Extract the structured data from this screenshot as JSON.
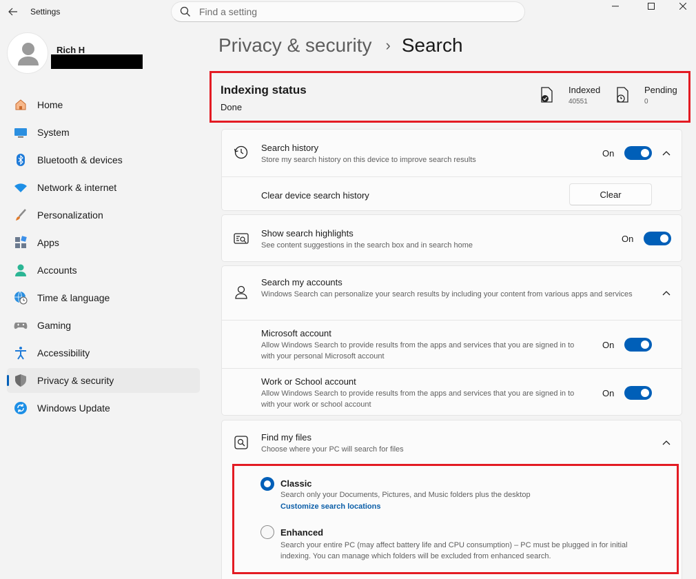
{
  "window": {
    "app_title": "Settings",
    "search_placeholder": "Find a setting"
  },
  "user": {
    "name": "Rich H"
  },
  "sidebar": {
    "items": [
      {
        "label": "Home",
        "icon": "home-icon"
      },
      {
        "label": "System",
        "icon": "system-icon"
      },
      {
        "label": "Bluetooth & devices",
        "icon": "bluetooth-icon"
      },
      {
        "label": "Network & internet",
        "icon": "wifi-icon"
      },
      {
        "label": "Personalization",
        "icon": "brush-icon"
      },
      {
        "label": "Apps",
        "icon": "apps-icon"
      },
      {
        "label": "Accounts",
        "icon": "accounts-icon"
      },
      {
        "label": "Time & language",
        "icon": "globe-clock-icon"
      },
      {
        "label": "Gaming",
        "icon": "gamepad-icon"
      },
      {
        "label": "Accessibility",
        "icon": "accessibility-icon"
      },
      {
        "label": "Privacy & security",
        "icon": "shield-icon"
      },
      {
        "label": "Windows Update",
        "icon": "update-icon"
      }
    ],
    "active_index": 10
  },
  "header": {
    "parent": "Privacy & security",
    "separator": "›",
    "current": "Search"
  },
  "indexing": {
    "title": "Indexing status",
    "status": "Done",
    "indexed_label": "Indexed",
    "indexed_value": "40551",
    "pending_label": "Pending",
    "pending_value": "0"
  },
  "search_history": {
    "title": "Search history",
    "desc": "Store my search history on this device to improve search results",
    "toggle_label": "On",
    "clear_label": "Clear device search history",
    "clear_button": "Clear"
  },
  "highlights": {
    "title": "Show search highlights",
    "desc": "See content suggestions in the search box and in search home",
    "toggle_label": "On"
  },
  "accounts": {
    "title": "Search my accounts",
    "desc": "Windows Search can personalize your search results by including your content from various apps and services",
    "microsoft": {
      "title": "Microsoft account",
      "desc": "Allow Windows Search to provide results from the apps and services that you are signed in to with your personal Microsoft account",
      "toggle_label": "On"
    },
    "work": {
      "title": "Work or School account",
      "desc": "Allow Windows Search to provide results from the apps and services that you are signed in to with your work or school account",
      "toggle_label": "On"
    }
  },
  "find_files": {
    "title": "Find my files",
    "desc": "Choose where your PC will search for files",
    "classic": {
      "title": "Classic",
      "desc": "Search only your Documents, Pictures, and Music folders plus the desktop",
      "link": "Customize search locations",
      "selected": true
    },
    "enhanced": {
      "title": "Enhanced",
      "desc": "Search your entire PC (may affect battery life and CPU consumption) – PC must be plugged in for initial indexing. You can manage which folders will be excluded from enhanced search.",
      "selected": false
    }
  },
  "colors": {
    "accent": "#005fb8",
    "highlight_border": "#e31b23",
    "link": "#0b5ea8"
  }
}
